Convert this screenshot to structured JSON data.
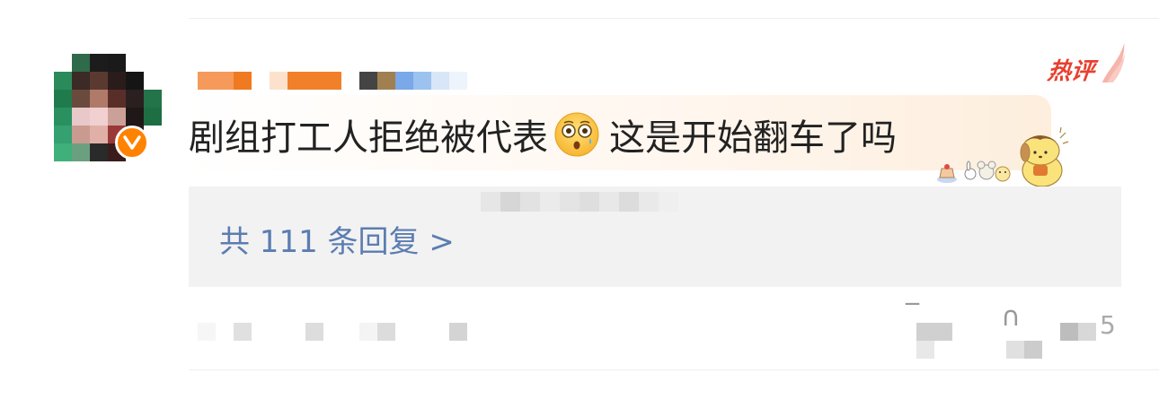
{
  "comment": {
    "text_before": "剧组打工人拒绝被代表",
    "emoji": "flushed-face-emoji",
    "text_after": "这是开始翻车了吗"
  },
  "hot_badge": {
    "label": "热评",
    "color": "#e8402f"
  },
  "avatar": {
    "verified_badge": "v-verified-icon",
    "badge_color": "#ff8200"
  },
  "replies": {
    "label": "共 111 条回复 >",
    "link_color": "#5b7db1"
  },
  "footer": {
    "like_count_visible_glyph": "5"
  },
  "icons": {
    "reply": "comment-icon",
    "like": "thumbs-up-icon",
    "more": "more-icon"
  }
}
